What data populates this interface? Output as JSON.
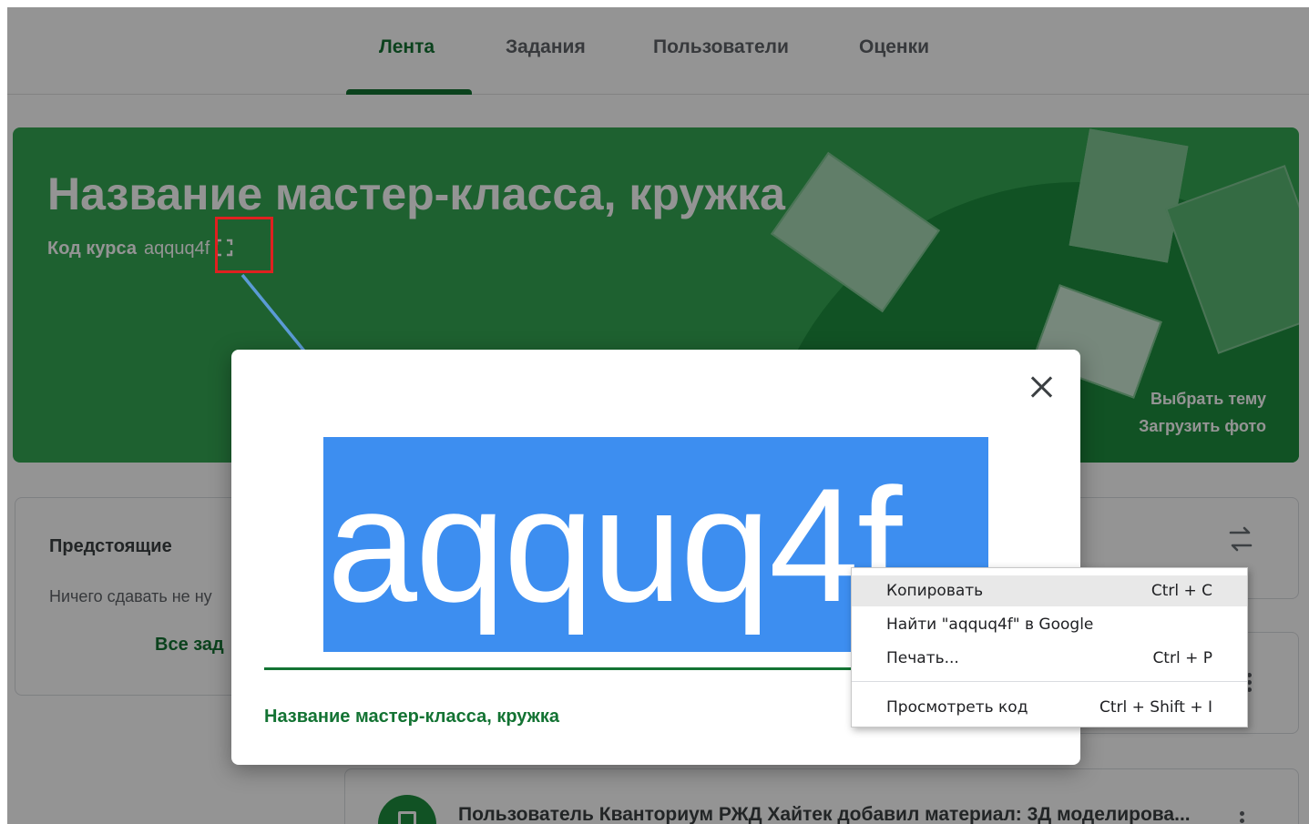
{
  "tabs": [
    {
      "label": "Лента",
      "active": true
    },
    {
      "label": "Задания",
      "active": false
    },
    {
      "label": "Пользователи",
      "active": false
    },
    {
      "label": "Оценки",
      "active": false
    }
  ],
  "banner": {
    "title": "Название мастер-класса, кружка",
    "course_code_label": "Код курса",
    "course_code_value": "aqquq4f",
    "select_theme": "Выбрать тему",
    "upload_photo": "Загрузить фото"
  },
  "upcoming": {
    "title": "Предстоящие",
    "text": "Ничего сдавать не ну",
    "all_tasks": "Все зад"
  },
  "post": {
    "text": "Пользователь Кванториум РЖД Хайтек добавил материал: 3Д моделирова..."
  },
  "modal": {
    "code": "aqquq4f",
    "course_name": "Название мастер-класса, кружка"
  },
  "context_menu": {
    "items": [
      {
        "label": "Копировать",
        "shortcut": "Ctrl + C"
      },
      {
        "label": "Найти \"aqquq4f\" в Google",
        "shortcut": ""
      },
      {
        "label": "Печать...",
        "shortcut": "Ctrl + P"
      },
      {
        "label": "Просмотреть код",
        "shortcut": "Ctrl + Shift + I"
      }
    ]
  },
  "colors": {
    "accent_green": "#137333",
    "banner_green": "#34a853",
    "selection_blue": "#3d8ef0",
    "highlight_red": "#e02020",
    "arrow_blue": "#5b9bd5"
  },
  "icons": [
    "expand-icon",
    "swap-icon",
    "close-icon",
    "kebab-icon",
    "material-icon"
  ]
}
